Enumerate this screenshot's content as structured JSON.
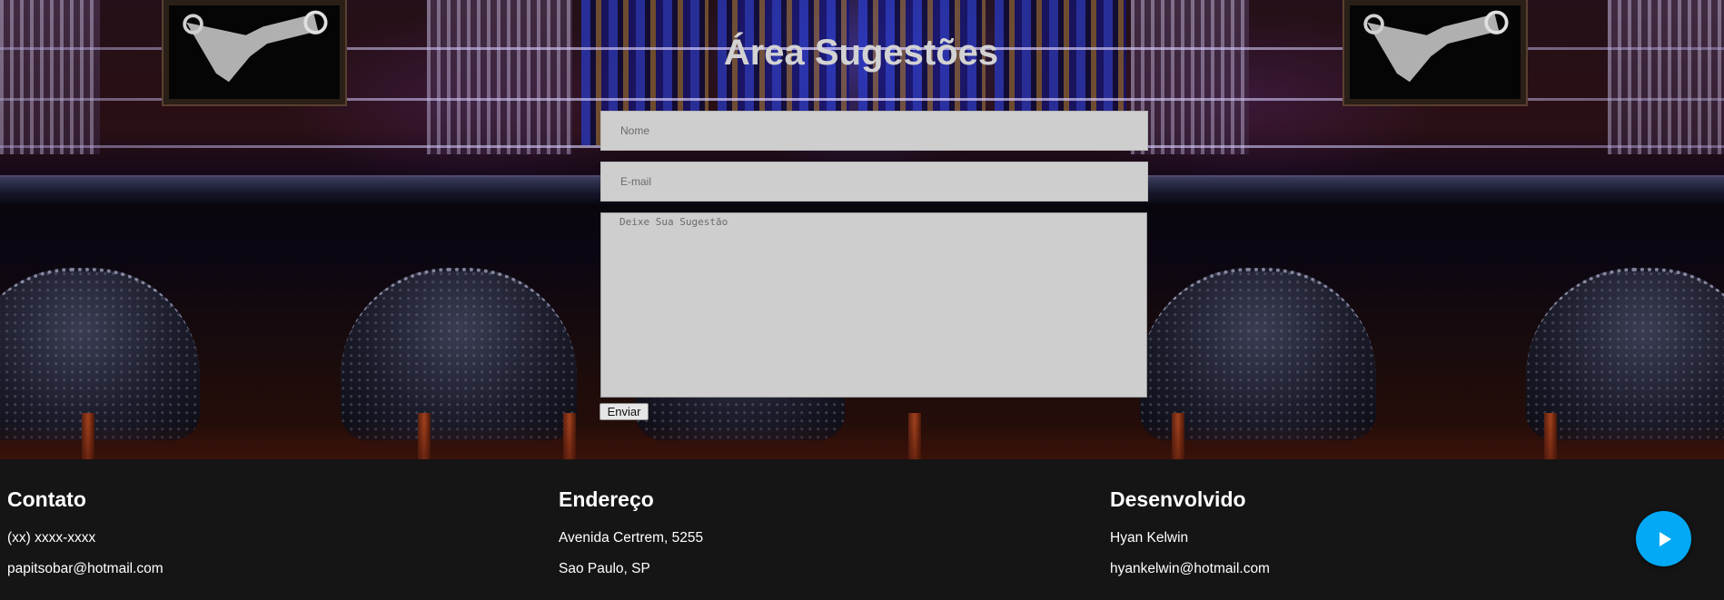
{
  "page": {
    "title": "Área Sugestões"
  },
  "form": {
    "name_placeholder": "Nome",
    "email_placeholder": "E-mail",
    "message_placeholder": "Deixe Sua Sugestão",
    "submit_label": "Enviar"
  },
  "footer": {
    "contact": {
      "heading": "Contato",
      "phone": "(xx) xxxx-xxxx",
      "email": "papitsobar@hotmail.com"
    },
    "address": {
      "heading": "Endereço",
      "street": "Avenida Certrem, 5255",
      "city": "Sao Paulo, SP"
    },
    "developer": {
      "heading": "Desenvolvido",
      "name": "Hyan Kelwin",
      "email": "hyankelwin@hotmail.com"
    }
  },
  "colors": {
    "play_button": "#03a9f4",
    "footer_background": "#151515",
    "input_background": "#cecece"
  },
  "icons": {
    "play": "play-icon"
  }
}
